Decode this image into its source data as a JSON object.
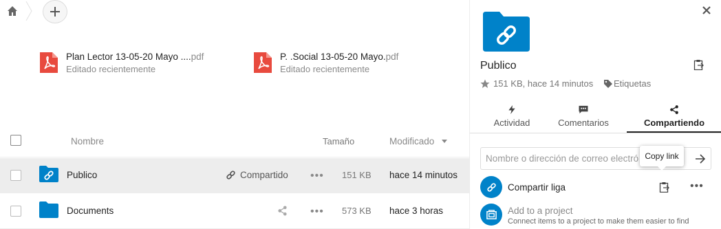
{
  "colors": {
    "accent": "#0082c9",
    "pdf": "#e84a3e"
  },
  "breadcrumb": {
    "home_icon": "home-icon",
    "add_icon": "plus-icon"
  },
  "recent": [
    {
      "name": "Plan Lector 13-05-20 Mayo ....",
      "ext": "pdf",
      "sub": "Editado recientemente"
    },
    {
      "name": "P. .Social 13-05-20 Mayo.",
      "ext": "pdf",
      "sub": "Editado recientemente"
    }
  ],
  "list": {
    "headers": {
      "name": "Nombre",
      "size": "Tamaño",
      "modified": "Modificado"
    },
    "rows": [
      {
        "name": "Publico",
        "shared_label": "Compartido",
        "more": "•••",
        "size": "151 KB",
        "modified": "hace 14 minutos"
      },
      {
        "name": "Documents",
        "more": "•••",
        "size": "573 KB",
        "modified": "hace 3 horas"
      }
    ]
  },
  "sidebar": {
    "title": "Publico",
    "meta": "151 KB, hace 14 minutos",
    "tags": "Etiquetas",
    "tabs": [
      {
        "label": "Actividad",
        "icon": "lightning-icon"
      },
      {
        "label": "Comentarios",
        "icon": "comment-icon"
      },
      {
        "label": "Compartiendo",
        "icon": "share-icon"
      }
    ],
    "share_placeholder": "Nombre o dirección de correo electró",
    "tooltip": "Copy link",
    "link_label": "Compartir liga",
    "more": "•••",
    "project_title": "Add to a project",
    "project_sub": "Connect items to a project to make them easier to find"
  }
}
